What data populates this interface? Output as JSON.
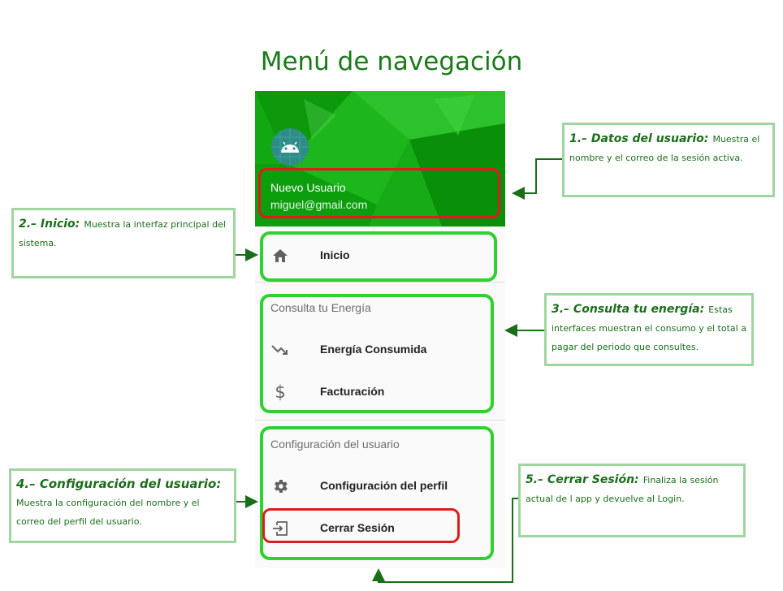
{
  "page_title": "Menú de navegación",
  "user": {
    "name": "Nuevo Usuario",
    "email": "miguel@gmail.com"
  },
  "menu": {
    "home_label": "Inicio",
    "section_energy_title": "Consulta tu Energía",
    "energy_consumed_label": "Energía Consumida",
    "billing_label": "Facturación",
    "section_user_title": "Configuración del usuario",
    "profile_settings_label": "Configuración del perfil",
    "logout_label": "Cerrar Sesión"
  },
  "icons": {
    "avatar": "android-icon",
    "home": "home-icon",
    "energy": "trending-down-icon",
    "billing": "dollar-icon",
    "settings": "gear-icon",
    "logout": "logout-icon"
  },
  "annotations": {
    "n1": {
      "heading": "1.– Datos del usuario:",
      "text": "Muestra el nombre y el correo  de la sesión activa."
    },
    "n2": {
      "heading": "2.– Inicio:",
      "text": "Muestra la interfaz principal del sistema."
    },
    "n3": {
      "heading": "3.– Consulta tu energía:",
      "text": "Estas interfaces muestran el consumo y el total a pagar del periodo que consultes."
    },
    "n4": {
      "heading": "4.– Configuración del usuario:",
      "text": "Muestra la configuración del nombre y el correo del perfil del usuario."
    },
    "n5": {
      "heading": "5.– Cerrar Sesión:",
      "text": "Finaliza la sesión actual de l app y devuelve al Login."
    }
  },
  "colors": {
    "header_green": "#11a311",
    "highlight_green": "#2fd12f",
    "highlight_red": "#e01b1b",
    "annotation_text": "#1a6e1a",
    "annotation_border": "#9fd59f"
  }
}
